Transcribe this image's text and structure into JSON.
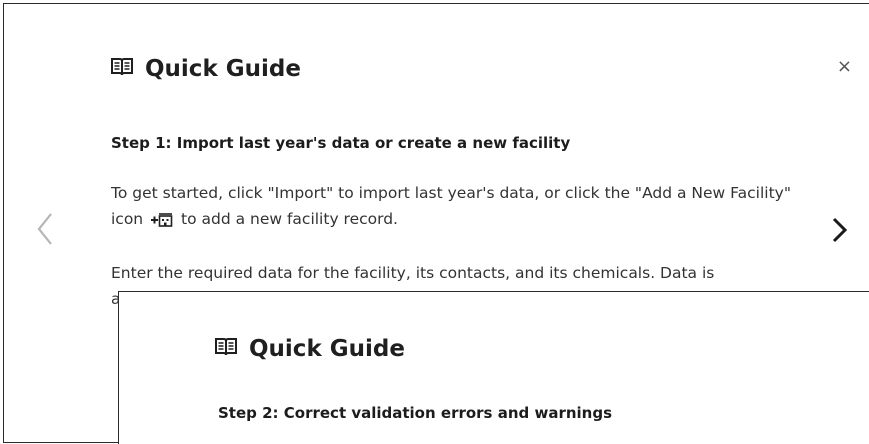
{
  "back_modal": {
    "title": "Quick Guide",
    "close_label": "×",
    "step_title": "Step 1: Import last year's data or create a new facility",
    "para1_a": "To get started, click \"Import\" to import last year's data, or click the \"Add a New Facility\" icon ",
    "para1_b": " to add a new facility record.",
    "para2": "Enter the required data for the facility, its contacts, and its chemicals. Data is automatically saved as you type it."
  },
  "front_modal": {
    "title": "Quick Guide",
    "step_title": "Step 2: Correct validation errors and warnings"
  },
  "icons": {
    "guide": "book-icon",
    "prev": "chevron-left-icon",
    "next": "chevron-right-icon",
    "add_facility": "add-facility-icon",
    "close": "close-icon"
  }
}
